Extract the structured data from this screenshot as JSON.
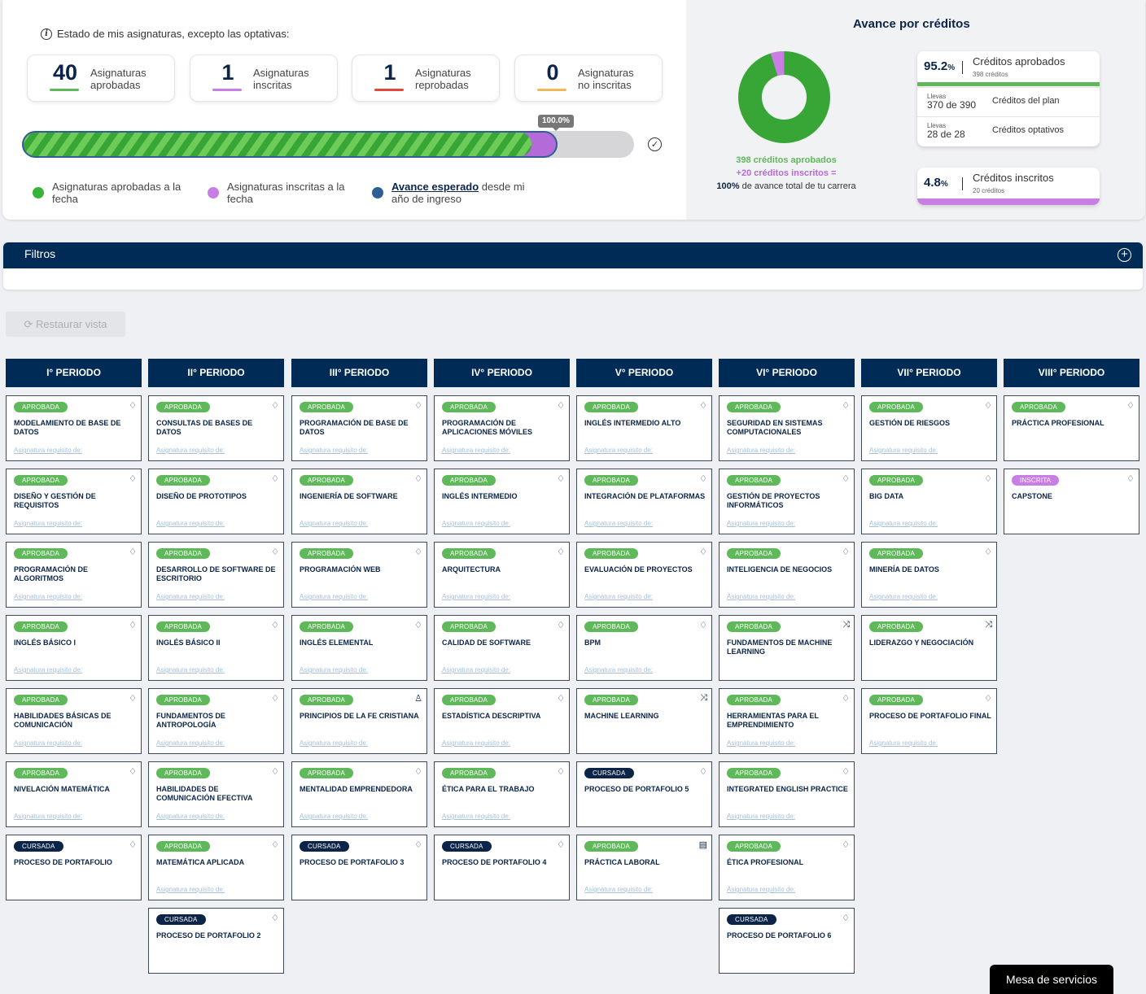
{
  "summary": {
    "info_text": "Estado de mis asignaturas, excepto las optativas:",
    "stats": [
      {
        "num": "40",
        "label1": "Asignaturas",
        "label2": "aprobadas",
        "color": "#5fb85a"
      },
      {
        "num": "1",
        "label1": "Asignaturas",
        "label2": "inscritas",
        "color": "#c97ee4"
      },
      {
        "num": "1",
        "label1": "Asignaturas",
        "label2": "reprobadas",
        "color": "#e0473e"
      },
      {
        "num": "0",
        "label1": "Asignaturas",
        "label2": "no inscritas",
        "color": "#f0b957"
      }
    ],
    "progress_label": "100.0%",
    "progress": {
      "approved_fraction": 0.952,
      "enrolled_fraction": 0.048,
      "total_fraction": 1.0
    },
    "legend": {
      "approved": "Asignaturas aprobadas a la fecha",
      "enrolled": "Asignaturas inscritas a la fecha",
      "expected_link": "Avance esperado",
      "expected_rest": " desde mi año de ingreso"
    }
  },
  "credits": {
    "title": "Avance por créditos",
    "donut_caption": {
      "approved": "398 créditos aprobados",
      "enrolled": "+20 créditos inscritos =",
      "total_bold": "100%",
      "total_rest": " de avance total de tu carrera"
    },
    "approved_card": {
      "pct": "95.2",
      "pct_sign": "%",
      "title": "Créditos aprobados",
      "sub": "398 créditos",
      "rows": [
        {
          "small": "Llevas",
          "value": "370 de 390",
          "label": "Créditos del plan"
        },
        {
          "small": "Llevas",
          "value": "28 de 28",
          "label": "Créditos optativos"
        }
      ]
    },
    "enrolled_card": {
      "pct": "4.8",
      "pct_sign": "%",
      "title": "Créditos inscritos",
      "sub": "20 créditos"
    },
    "colors": {
      "approved": "#37a636",
      "enrolled": "#c97ee4"
    },
    "donut_values": {
      "approved": 398,
      "enrolled": 20
    }
  },
  "filters": {
    "title": "Filtros"
  },
  "restore_label": "Restaurar vista",
  "req_label": "Asignatura requisito de:",
  "periods": [
    {
      "title": "I° PERIODO",
      "courses": [
        {
          "status": "APROBADA",
          "name": "Modelamiento de base de datos",
          "icon": "diamond-icon",
          "req": true
        },
        {
          "status": "APROBADA",
          "name": "Diseño y gestión de requisitos",
          "icon": "diamond-icon",
          "req": true
        },
        {
          "status": "APROBADA",
          "name": "Programación de algoritmos",
          "icon": "diamond-icon",
          "req": true
        },
        {
          "status": "APROBADA",
          "name": "Inglés básico I",
          "icon": "diamond-icon",
          "req": true
        },
        {
          "status": "APROBADA",
          "name": "Habilidades básicas de comunicación",
          "icon": "diamond-icon",
          "req": true
        },
        {
          "status": "APROBADA",
          "name": "Nivelación matemática",
          "icon": "diamond-icon",
          "req": true
        },
        {
          "status": "CURSADA",
          "name": "Proceso de portafolio",
          "icon": "diamond-icon",
          "req": false
        }
      ]
    },
    {
      "title": "II° PERIODO",
      "courses": [
        {
          "status": "APROBADA",
          "name": "Consultas de bases de datos",
          "icon": "diamond-icon",
          "req": true
        },
        {
          "status": "APROBADA",
          "name": "Diseño de prototipos",
          "icon": "diamond-icon",
          "req": true
        },
        {
          "status": "APROBADA",
          "name": "Desarrollo de software de escritorio",
          "icon": "diamond-icon",
          "req": true
        },
        {
          "status": "APROBADA",
          "name": "Inglés básico II",
          "icon": "diamond-icon",
          "req": true
        },
        {
          "status": "APROBADA",
          "name": "Fundamentos de antropología",
          "icon": "diamond-icon",
          "req": true
        },
        {
          "status": "APROBADA",
          "name": "Habilidades de comunicación efectiva",
          "icon": "diamond-icon",
          "req": true
        },
        {
          "status": "APROBADA",
          "name": "Matemática aplicada",
          "icon": "diamond-icon",
          "req": true
        },
        {
          "status": "CURSADA",
          "name": "Proceso de portafolio 2",
          "icon": "diamond-icon",
          "req": false
        }
      ]
    },
    {
      "title": "III° PERIODO",
      "courses": [
        {
          "status": "APROBADA",
          "name": "Programación de base de datos",
          "icon": "diamond-icon",
          "req": true
        },
        {
          "status": "APROBADA",
          "name": "Ingeniería de software",
          "icon": "diamond-icon",
          "req": true
        },
        {
          "status": "APROBADA",
          "name": "Programación web",
          "icon": "diamond-icon",
          "req": true
        },
        {
          "status": "APROBADA",
          "name": "Inglés elemental",
          "icon": "diamond-icon",
          "req": true
        },
        {
          "status": "APROBADA",
          "name": "Principios de la fe cristiana",
          "icon": "figure-icon",
          "req": true
        },
        {
          "status": "APROBADA",
          "name": "Mentalidad emprendedora",
          "icon": "diamond-icon",
          "req": true
        },
        {
          "status": "CURSADA",
          "name": "Proceso de portafolio 3",
          "icon": "diamond-icon",
          "req": false
        }
      ]
    },
    {
      "title": "IV° PERIODO",
      "courses": [
        {
          "status": "APROBADA",
          "name": "Programación de aplicaciones móviles",
          "icon": "diamond-icon",
          "req": true
        },
        {
          "status": "APROBADA",
          "name": "Inglés intermedio",
          "icon": "diamond-icon",
          "req": true
        },
        {
          "status": "APROBADA",
          "name": "Arquitectura",
          "icon": "diamond-icon",
          "req": true
        },
        {
          "status": "APROBADA",
          "name": "Calidad de software",
          "icon": "diamond-icon",
          "req": true
        },
        {
          "status": "APROBADA",
          "name": "Estadística descriptiva",
          "icon": "diamond-icon",
          "req": true
        },
        {
          "status": "APROBADA",
          "name": "Ética para el trabajo",
          "icon": "diamond-icon",
          "req": true
        },
        {
          "status": "CURSADA",
          "name": "Proceso de portafolio 4",
          "icon": "diamond-icon",
          "req": false
        }
      ]
    },
    {
      "title": "V° PERIODO",
      "courses": [
        {
          "status": "APROBADA",
          "name": "Inglés intermedio alto",
          "icon": "diamond-icon",
          "req": true
        },
        {
          "status": "APROBADA",
          "name": "Integración de plataformas",
          "icon": "diamond-icon",
          "req": true
        },
        {
          "status": "APROBADA",
          "name": "Evaluación de proyectos",
          "icon": "diamond-icon",
          "req": true
        },
        {
          "status": "APROBADA",
          "name": "BPM",
          "icon": "diamond-icon",
          "req": true
        },
        {
          "status": "APROBADA",
          "name": "Machine learning",
          "icon": "shuffle-icon",
          "req": false
        },
        {
          "status": "CURSADA",
          "name": "Proceso de portafolio 5",
          "icon": "diamond-icon",
          "req": false
        },
        {
          "status": "APROBADA",
          "name": "Práctica laboral",
          "icon": "briefcase-icon",
          "req": true
        }
      ]
    },
    {
      "title": "VI° PERIODO",
      "courses": [
        {
          "status": "APROBADA",
          "name": "Seguridad en sistemas computacionales",
          "icon": "diamond-icon",
          "req": true
        },
        {
          "status": "APROBADA",
          "name": "Gestión de proyectos informáticos",
          "icon": "diamond-icon",
          "req": true
        },
        {
          "status": "APROBADA",
          "name": "Inteligencia de negocios",
          "icon": "diamond-icon",
          "req": true
        },
        {
          "status": "APROBADA",
          "name": "Fundamentos de machine learning",
          "icon": "shuffle-icon",
          "req": false
        },
        {
          "status": "APROBADA",
          "name": "Herramientas para el emprendimiento",
          "icon": "diamond-icon",
          "req": true
        },
        {
          "status": "APROBADA",
          "name": "Integrated English Practice",
          "icon": "diamond-icon",
          "req": true
        },
        {
          "status": "APROBADA",
          "name": "Ética profesional",
          "icon": "diamond-icon",
          "req": true
        },
        {
          "status": "CURSADA",
          "name": "Proceso de portafolio 6",
          "icon": "diamond-icon",
          "req": false
        }
      ]
    },
    {
      "title": "VII° PERIODO",
      "courses": [
        {
          "status": "APROBADA",
          "name": "Gestión de riesgos",
          "icon": "diamond-icon",
          "req": true
        },
        {
          "status": "APROBADA",
          "name": "Big data",
          "icon": "diamond-icon",
          "req": true
        },
        {
          "status": "APROBADA",
          "name": "Minería de datos",
          "icon": "diamond-icon",
          "req": true
        },
        {
          "status": "APROBADA",
          "name": "Liderazgo y negociación",
          "icon": "shuffle-icon",
          "req": false
        },
        {
          "status": "APROBADA",
          "name": "Proceso de portafolio final",
          "icon": "diamond-icon",
          "req": true
        }
      ]
    },
    {
      "title": "VIII° PERIODO",
      "courses": [
        {
          "status": "APROBADA",
          "name": "Práctica profesional",
          "icon": "diamond-icon",
          "req": false
        },
        {
          "status": "INSCRITA",
          "name": "Capstone",
          "icon": "diamond-icon",
          "req": false
        }
      ]
    }
  ],
  "service_desk": "Mesa de servicios"
}
